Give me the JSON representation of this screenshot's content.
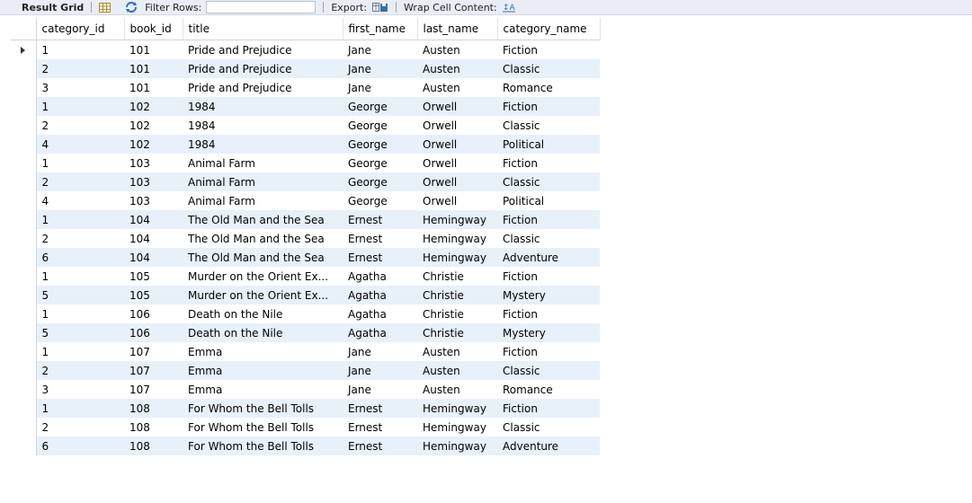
{
  "toolbar": {
    "title": "Result Grid",
    "filter_label": "Filter Rows:",
    "filter_value": "",
    "export_label": "Export:",
    "wrap_label": "Wrap Cell Content:",
    "icons": [
      "grid-icon",
      "refresh-icon",
      "export-icon",
      "wrap-icon"
    ]
  },
  "table": {
    "columns": [
      "category_id",
      "book_id",
      "title",
      "first_name",
      "last_name",
      "category_name"
    ],
    "rows": [
      [
        "1",
        "101",
        "Pride and Prejudice",
        "Jane",
        "Austen",
        "Fiction"
      ],
      [
        "2",
        "101",
        "Pride and Prejudice",
        "Jane",
        "Austen",
        "Classic"
      ],
      [
        "3",
        "101",
        "Pride and Prejudice",
        "Jane",
        "Austen",
        "Romance"
      ],
      [
        "1",
        "102",
        "1984",
        "George",
        "Orwell",
        "Fiction"
      ],
      [
        "2",
        "102",
        "1984",
        "George",
        "Orwell",
        "Classic"
      ],
      [
        "4",
        "102",
        "1984",
        "George",
        "Orwell",
        "Political"
      ],
      [
        "1",
        "103",
        "Animal Farm",
        "George",
        "Orwell",
        "Fiction"
      ],
      [
        "2",
        "103",
        "Animal Farm",
        "George",
        "Orwell",
        "Classic"
      ],
      [
        "4",
        "103",
        "Animal Farm",
        "George",
        "Orwell",
        "Political"
      ],
      [
        "1",
        "104",
        "The Old Man and the Sea",
        "Ernest",
        "Hemingway",
        "Fiction"
      ],
      [
        "2",
        "104",
        "The Old Man and the Sea",
        "Ernest",
        "Hemingway",
        "Classic"
      ],
      [
        "6",
        "104",
        "The Old Man and the Sea",
        "Ernest",
        "Hemingway",
        "Adventure"
      ],
      [
        "1",
        "105",
        "Murder on the Orient Ex...",
        "Agatha",
        "Christie",
        "Fiction"
      ],
      [
        "5",
        "105",
        "Murder on the Orient Ex...",
        "Agatha",
        "Christie",
        "Mystery"
      ],
      [
        "1",
        "106",
        "Death on the Nile",
        "Agatha",
        "Christie",
        "Fiction"
      ],
      [
        "5",
        "106",
        "Death on the Nile",
        "Agatha",
        "Christie",
        "Mystery"
      ],
      [
        "1",
        "107",
        "Emma",
        "Jane",
        "Austen",
        "Fiction"
      ],
      [
        "2",
        "107",
        "Emma",
        "Jane",
        "Austen",
        "Classic"
      ],
      [
        "3",
        "107",
        "Emma",
        "Jane",
        "Austen",
        "Romance"
      ],
      [
        "1",
        "108",
        "For Whom the Bell Tolls",
        "Ernest",
        "Hemingway",
        "Fiction"
      ],
      [
        "2",
        "108",
        "For Whom the Bell Tolls",
        "Ernest",
        "Hemingway",
        "Classic"
      ],
      [
        "6",
        "108",
        "For Whom the Bell Tolls",
        "Ernest",
        "Hemingway",
        "Adventure"
      ]
    ],
    "current_row": 0
  },
  "colors": {
    "toolbar_bg": "#e9eef6",
    "row_alt": "#e8f0fa",
    "accent": "#2f6fb5"
  }
}
